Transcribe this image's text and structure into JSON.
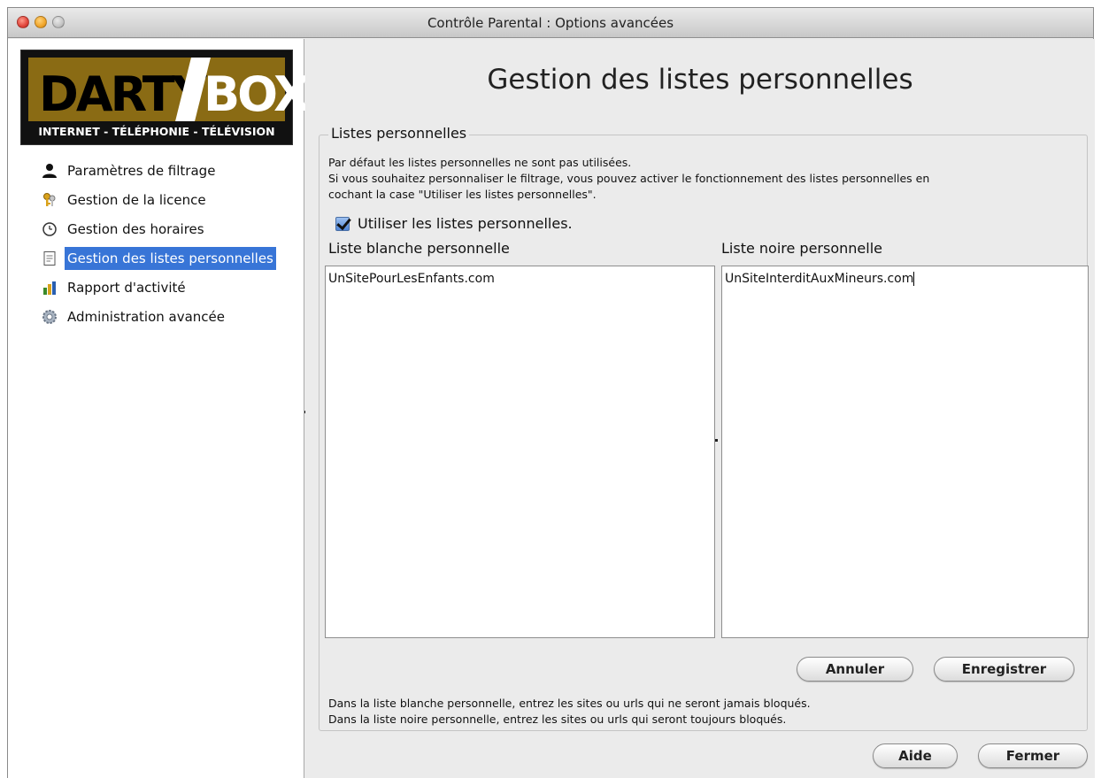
{
  "window": {
    "title": "Contrôle Parental : Options avancées"
  },
  "logo": {
    "brand_left": "DARTY",
    "brand_right": "BOX",
    "tagline": "INTERNET - TÉLÉPHONIE - TÉLÉVISION"
  },
  "sidebar": {
    "items": [
      {
        "label": "Paramètres de filtrage",
        "icon": "user-icon",
        "selected": false
      },
      {
        "label": "Gestion de la licence",
        "icon": "keys-icon",
        "selected": false
      },
      {
        "label": "Gestion des horaires",
        "icon": "clock-icon",
        "selected": false
      },
      {
        "label": "Gestion des listes personnelles",
        "icon": "document-icon",
        "selected": true
      },
      {
        "label": "Rapport d'activité",
        "icon": "chart-icon",
        "selected": false
      },
      {
        "label": "Administration avancée",
        "icon": "gear-icon",
        "selected": false
      }
    ]
  },
  "main": {
    "title": "Gestion des listes personnelles",
    "group_title": "Listes personnelles",
    "description": [
      "Par défaut les listes personnelles ne sont pas utilisées.",
      "Si vous souhaitez personnaliser le filtrage, vous pouvez activer le fonctionnement des listes personnelles en",
      "cochant la case \"Utiliser les listes personnelles\"."
    ],
    "checkbox_label": "Utiliser les listes personnelles.",
    "checkbox_checked": true,
    "whitelist_label": "Liste blanche personnelle",
    "whitelist_value": "UnSitePourLesEnfants.com",
    "blacklist_label": "Liste noire personnelle",
    "blacklist_value": "UnSiteInterditAuxMineurs.com",
    "cancel_label": "Annuler",
    "save_label": "Enregistrer",
    "help_text": [
      "Dans la liste blanche personnelle, entrez les sites ou urls qui ne seront jamais bloqués.",
      "Dans la liste noire personnelle, entrez les sites ou urls qui seront toujours bloqués."
    ]
  },
  "footer": {
    "help_label": "Aide",
    "close_label": "Fermer"
  },
  "colors": {
    "selection": "#3875d7",
    "logo_gold": "#8a6b14",
    "window_bg": "#ebebeb"
  }
}
